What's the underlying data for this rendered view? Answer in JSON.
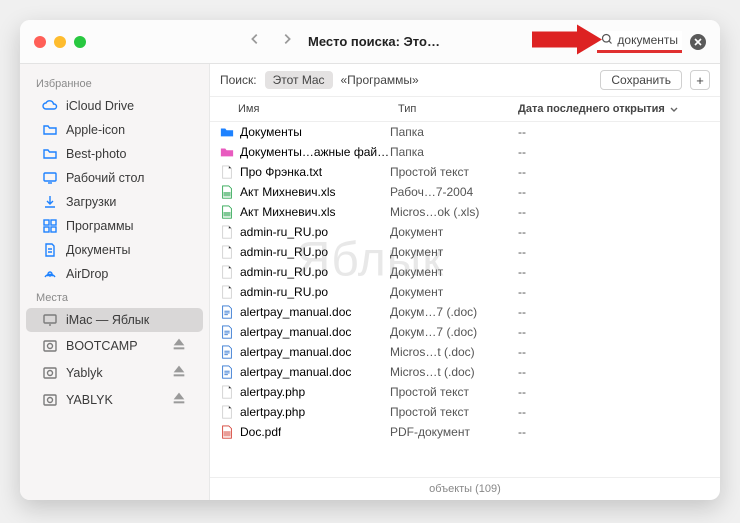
{
  "window": {
    "title": "Место поиска: Это…"
  },
  "search": {
    "query": "документы"
  },
  "scopebar": {
    "label": "Поиск:",
    "active_scope": "Этот Mac",
    "other_scope": "«Программы»",
    "save": "Сохранить"
  },
  "columns": {
    "name": "Имя",
    "type": "Тип",
    "date": "Дата последнего открытия"
  },
  "sidebar": {
    "sections": [
      {
        "title": "Избранное",
        "items": [
          {
            "icon": "cloud",
            "label": "iCloud Drive"
          },
          {
            "icon": "folder",
            "label": "Apple-icon"
          },
          {
            "icon": "folder",
            "label": "Best-photo"
          },
          {
            "icon": "desktop",
            "label": "Рабочий стол"
          },
          {
            "icon": "download",
            "label": "Загрузки"
          },
          {
            "icon": "apps",
            "label": "Программы"
          },
          {
            "icon": "docs",
            "label": "Документы"
          },
          {
            "icon": "airdrop",
            "label": "AirDrop"
          }
        ]
      },
      {
        "title": "Места",
        "items": [
          {
            "icon": "imac",
            "label": "iMac — Яблык",
            "selected": true
          },
          {
            "icon": "disk",
            "label": "BOOTCAMP",
            "eject": true
          },
          {
            "icon": "disk",
            "label": "Yablyk",
            "eject": true
          },
          {
            "icon": "disk",
            "label": "YABLYK",
            "eject": true
          }
        ]
      }
    ]
  },
  "files": [
    {
      "icon": "folder-blue",
      "name": "Документы",
      "type": "Папка",
      "date": "--"
    },
    {
      "icon": "folder-pink",
      "name": "Документы…ажные файлы",
      "type": "Папка",
      "date": "--"
    },
    {
      "icon": "doc-gray",
      "name": "Про Фрэнка.txt",
      "type": "Простой текст",
      "date": "--"
    },
    {
      "icon": "doc-green",
      "name": "Акт Михневич.xls",
      "type": "Рабоч…7-2004",
      "date": "--"
    },
    {
      "icon": "doc-green",
      "name": "Акт Михневич.xls",
      "type": "Micros…ok (.xls)",
      "date": "--"
    },
    {
      "icon": "doc-gray",
      "name": "admin-ru_RU.po",
      "type": "Документ",
      "date": "--"
    },
    {
      "icon": "doc-gray",
      "name": "admin-ru_RU.po",
      "type": "Документ",
      "date": "--"
    },
    {
      "icon": "doc-gray",
      "name": "admin-ru_RU.po",
      "type": "Документ",
      "date": "--"
    },
    {
      "icon": "doc-gray",
      "name": "admin-ru_RU.po",
      "type": "Документ",
      "date": "--"
    },
    {
      "icon": "doc-blue",
      "name": "alertpay_manual.doc",
      "type": "Докум…7 (.doc)",
      "date": "--"
    },
    {
      "icon": "doc-blue",
      "name": "alertpay_manual.doc",
      "type": "Докум…7 (.doc)",
      "date": "--"
    },
    {
      "icon": "doc-blue",
      "name": "alertpay_manual.doc",
      "type": "Micros…t (.doc)",
      "date": "--"
    },
    {
      "icon": "doc-blue",
      "name": "alertpay_manual.doc",
      "type": "Micros…t (.doc)",
      "date": "--"
    },
    {
      "icon": "doc-gray",
      "name": "alertpay.php",
      "type": "Простой текст",
      "date": "--"
    },
    {
      "icon": "doc-gray",
      "name": "alertpay.php",
      "type": "Простой текст",
      "date": "--"
    },
    {
      "icon": "doc-red",
      "name": "Doc.pdf",
      "type": "PDF-документ",
      "date": "--"
    }
  ],
  "status": "объекты (109)",
  "watermark": "Яблык"
}
